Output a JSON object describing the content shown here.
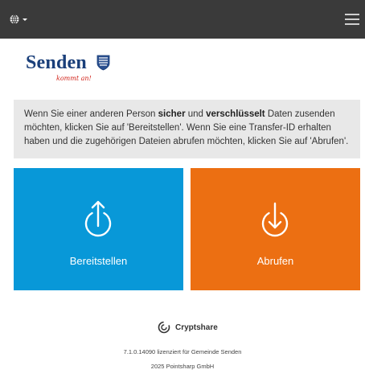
{
  "header": {
    "language_icon": "globe-icon",
    "menu_icon": "hamburger-menu-icon",
    "colors": {
      "background": "#3a3a3a"
    }
  },
  "logo": {
    "name": "Senden",
    "tagline": "kommt an!",
    "crest_icon": "coat-of-arms-icon"
  },
  "info": {
    "p1": "Wenn Sie einer anderen Person ",
    "p1_bold": "sicher",
    "p2": " und ",
    "p2_bold": "verschlüsselt",
    "p3": " Daten zusenden möchten, klicken Sie auf 'Bereitstellen'. Wenn Sie eine Transfer-ID erhalten haben und die zugehörigen Dateien abrufen möchten, klicken Sie auf 'Abrufen'."
  },
  "tiles": {
    "provide": {
      "label": "Bereitstellen",
      "icon": "upload-arrow-circle-icon",
      "color": "#0898d8"
    },
    "fetch": {
      "label": "Abrufen",
      "icon": "download-arrow-circle-icon",
      "color": "#ec6f12"
    }
  },
  "footer": {
    "brand": "Cryptshare",
    "brand_icon": "cryptshare-logo-icon",
    "version_line": "7.1.0.14090 lizenziert für Gemeinde Senden",
    "copyright_line": "2025 Pointsharp GmbH"
  }
}
